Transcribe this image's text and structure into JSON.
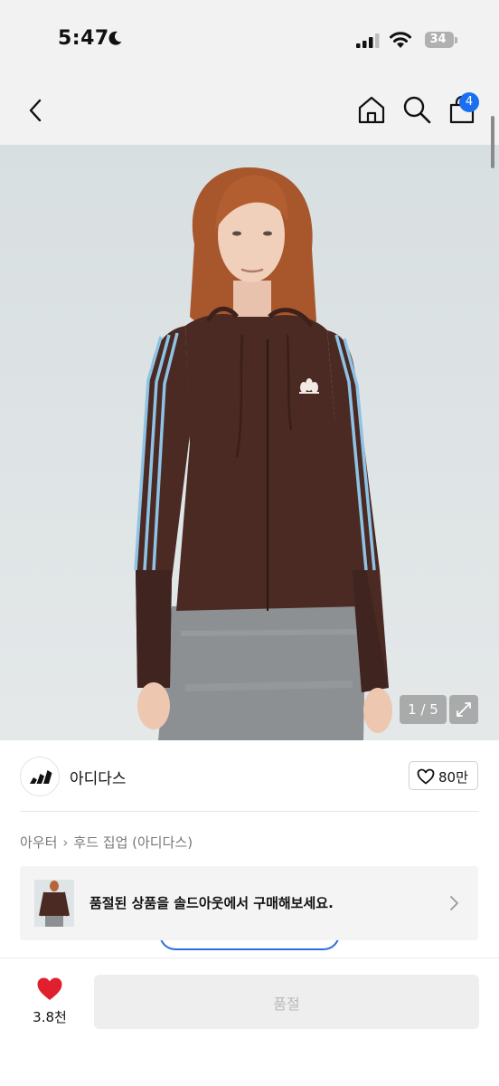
{
  "status_bar": {
    "time": "5:47",
    "battery": "34"
  },
  "header": {
    "cart_count": "4"
  },
  "gallery": {
    "counter": "1 / 5"
  },
  "brand": {
    "name": "아디다스",
    "likes": "80만"
  },
  "breadcrumb": {
    "category": "아우터",
    "subcategory": "후드 집업 (아디다스)"
  },
  "soldout_banner": {
    "text": "품절된 상품을 솔드아웃에서 구매해보세요."
  },
  "bottom_bar": {
    "wish_count": "3.8천",
    "buy_label": "품절"
  },
  "colors": {
    "accent": "#1a6ff0",
    "wish_heart": "#e0202d",
    "jacket": "#4a2a22",
    "stripe": "#8fc3e6"
  }
}
